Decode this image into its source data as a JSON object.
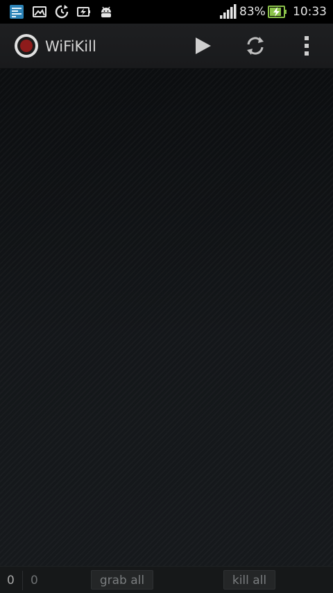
{
  "status_bar": {
    "icons_left": [
      "app-notification-icon",
      "gallery-icon",
      "sync-icon",
      "battery-saver-icon",
      "android-debug-icon"
    ],
    "signal_icon": "signal-bars-icon",
    "battery_percent": "83%",
    "battery_icon": "battery-charging-icon",
    "time": "10:33",
    "battery_color": "#8bc34a"
  },
  "action_bar": {
    "title": "WiFiKill",
    "app_icon": "record-icon",
    "actions": [
      "play-icon",
      "refresh-icon",
      "overflow-menu-icon"
    ],
    "accent_color": "#8e1b1b"
  },
  "bottom_bar": {
    "count_left": "0",
    "count_right": "0",
    "grab_all_label": "grab all",
    "kill_all_label": "kill all"
  }
}
